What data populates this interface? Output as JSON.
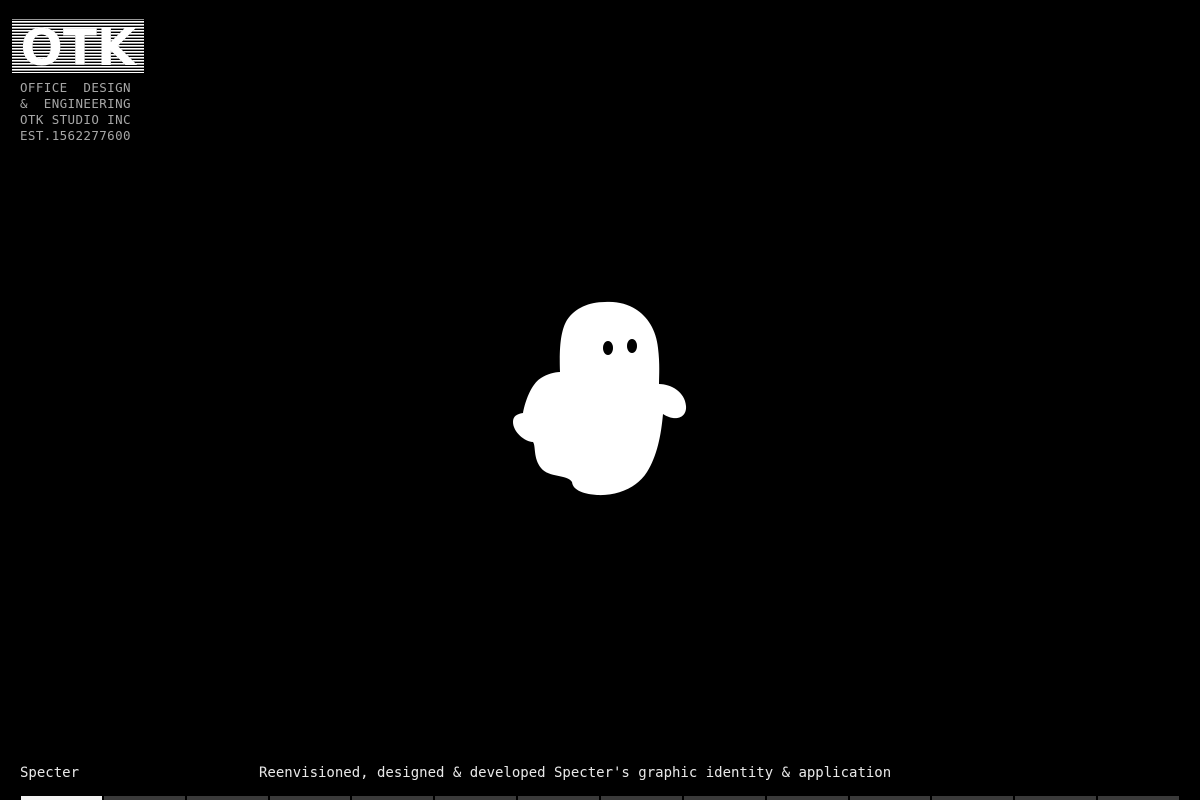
{
  "brand": {
    "logo_text": "OTK",
    "lines": [
      "OFFICE  DESIGN",
      "&  ENGINEERING",
      "OTK STUDIO INC",
      "EST.1562277600"
    ]
  },
  "project": {
    "name": "Specter",
    "description": "Reenvisioned, designed & developed Specter's graphic identity & application"
  },
  "illustration": {
    "icon": "ghost-icon"
  },
  "progress": {
    "total_segments": 14,
    "active_index": 0
  },
  "colors": {
    "background": "#000000",
    "text": "#e8e8e8",
    "muted_text": "#a6a6a6",
    "segment_active": "#f2f2f2",
    "segment_inactive": "#3a3a3a"
  }
}
